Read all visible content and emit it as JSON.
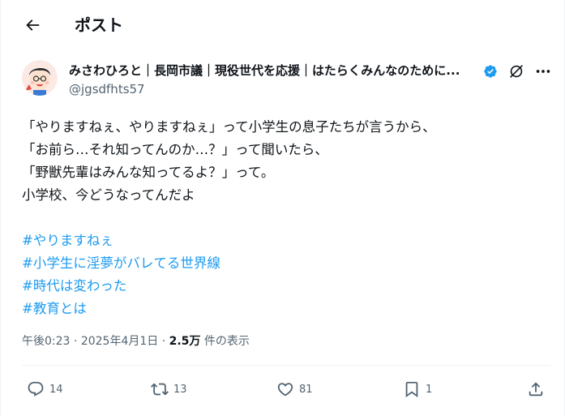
{
  "header": {
    "title": "ポスト"
  },
  "author": {
    "display_name": "みさわひろと｜長岡市議｜現役世代を応援｜はたらくみんなのために...",
    "handle": "@jgsdfhts57",
    "verified": true,
    "accent": "#1d9bf0"
  },
  "tweet": {
    "lines": [
      "「やりますねぇ、やりますねぇ」って小学生の息子たちが言うから、",
      "「お前ら…それ知ってんのか…？」って聞いたら、",
      "「野獣先輩はみんな知ってるよ？」って。",
      "小学校、今どうなってんだよ"
    ],
    "hashtags": [
      "#やりますねぇ",
      "#小学生に淫夢がバレてる世界線",
      "#時代は変わった",
      "#教育とは"
    ]
  },
  "meta": {
    "time": "午後0:23",
    "sep1": " · ",
    "date": "2025年4月1日",
    "sep2": " · ",
    "views": "2.5万",
    "views_suffix": " 件の表示"
  },
  "actions": {
    "replies": "14",
    "reposts": "13",
    "likes": "81",
    "bookmarks": "1"
  },
  "icons": {
    "back": "arrow-left-icon",
    "verified": "verified-badge-icon",
    "grok": "grok-icon",
    "more": "more-icon",
    "reply": "reply-icon",
    "repost": "repost-icon",
    "like": "heart-icon",
    "bookmark": "bookmark-icon",
    "share": "share-icon"
  },
  "colors": {
    "text": "#0f1419",
    "secondary": "#536471",
    "link": "#1d9bf0",
    "border": "#eff3f4"
  }
}
